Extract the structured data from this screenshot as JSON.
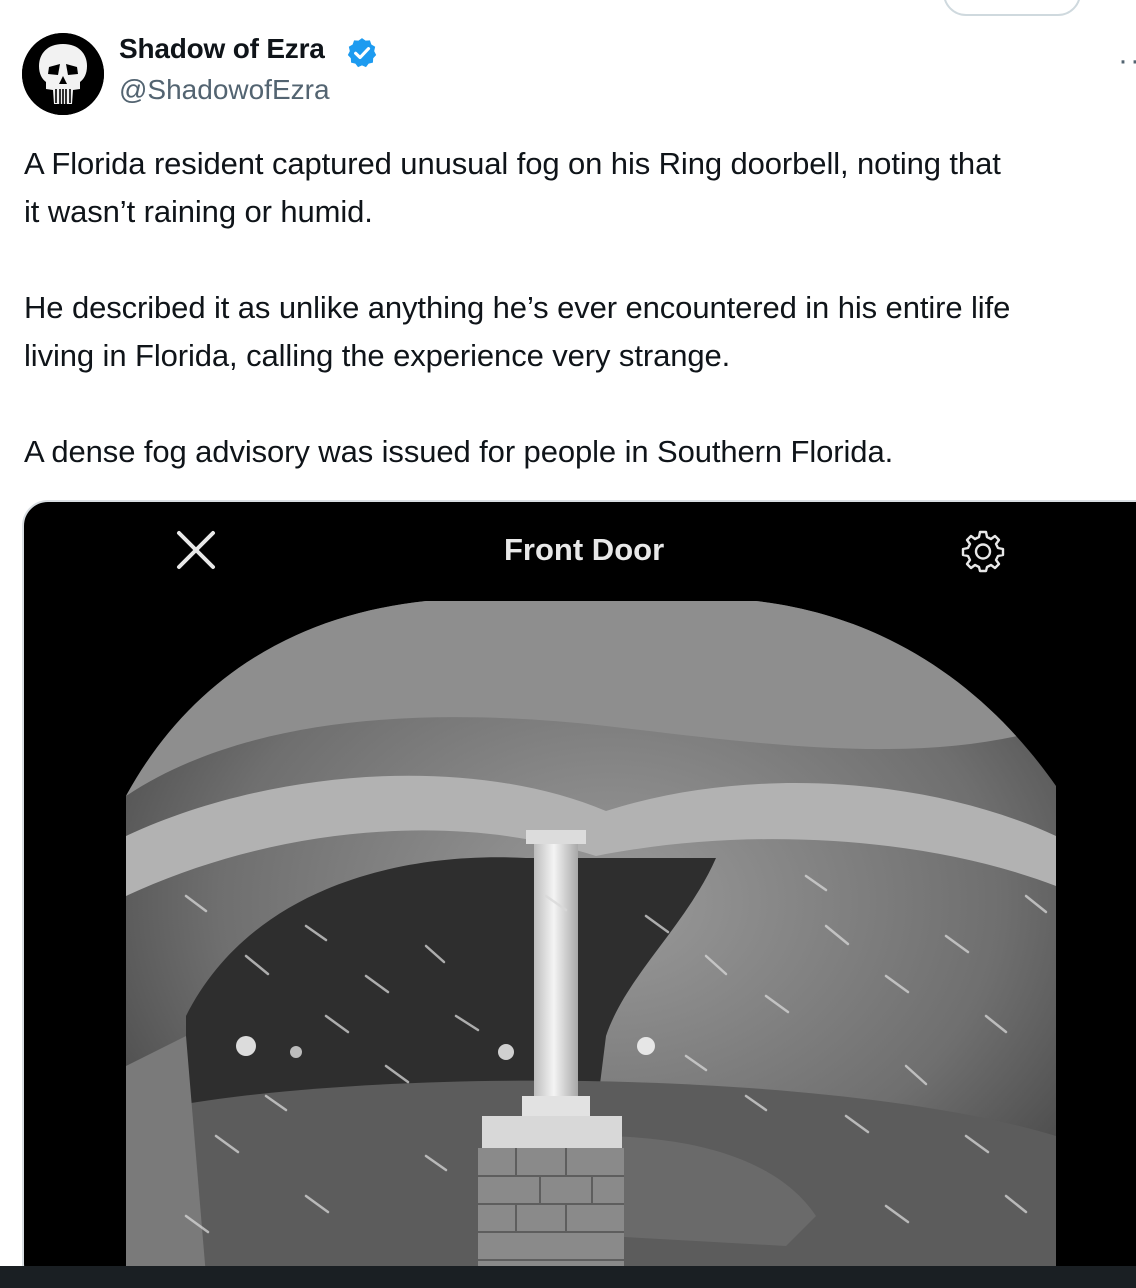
{
  "author": {
    "name": "Shadow of Ezra",
    "handle": "@ShadowofEzra",
    "verified": true,
    "verified_color": "#1d9bf0"
  },
  "tweet": {
    "paragraphs": [
      [
        "A Florida resident captured unusual fog on his Ring doorbell, noting that",
        "it wasn’t raining or humid."
      ],
      [
        "He described it as unlike anything he’s ever encountered in his entire life",
        "living in Florida, calling the experience very strange."
      ],
      [
        "A dense fog advisory was issued for people in Southern Florida."
      ]
    ]
  },
  "media": {
    "title": "Front Door",
    "close_icon": "close-icon",
    "settings_icon": "gear-icon",
    "image_type": "night-vision doorbell camera view of front porch with pillar and fog"
  },
  "icons": {
    "more": "more-icon",
    "avatar": "punisher-skull-logo"
  }
}
